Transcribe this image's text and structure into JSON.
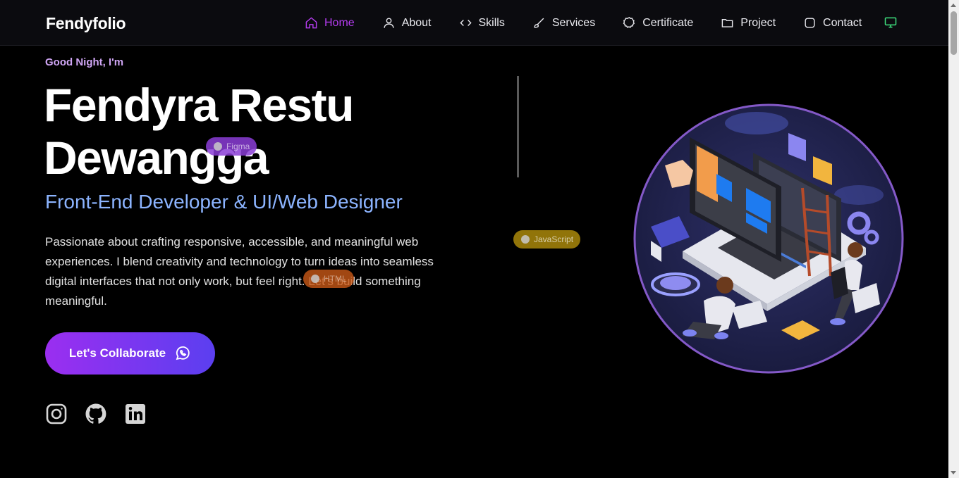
{
  "brand": "Fendyfolio",
  "nav": {
    "items": [
      {
        "label": "Home",
        "icon": "home-icon",
        "active": true
      },
      {
        "label": "About",
        "icon": "user-icon"
      },
      {
        "label": "Skills",
        "icon": "code-icon"
      },
      {
        "label": "Services",
        "icon": "brush-icon"
      },
      {
        "label": "Certificate",
        "icon": "badge-icon"
      },
      {
        "label": "Project",
        "icon": "folder-icon"
      },
      {
        "label": "Contact",
        "icon": "chat-icon"
      }
    ],
    "theme_icon": "monitor-icon"
  },
  "hero": {
    "greeting": "Good Night, I'm",
    "name_line1": "Fendyra Restu",
    "name_line2": "Dewangga",
    "role": "Front-End Developer & UI/Web Designer",
    "description": "Passionate about crafting responsive, accessible, and meaningful web experiences. I blend creativity and technology to turn ideas into seamless digital interfaces that not only work, but feel right. Let’s build something meaningful.",
    "cta_label": "Let's Collaborate",
    "cta_icon": "whatsapp-icon"
  },
  "badges": {
    "figma": "Figma",
    "javascript": "JavaScript",
    "html": "HTML"
  },
  "socials": [
    "instagram-icon",
    "github-icon",
    "linkedin-icon"
  ],
  "colors": {
    "accent": "#b53cf0",
    "role": "#8cb4ff",
    "greeting": "#d0a6f5",
    "cta_start": "#9b2ef0",
    "cta_end": "#5b3ff0",
    "theme_icon": "#3ee07e"
  }
}
